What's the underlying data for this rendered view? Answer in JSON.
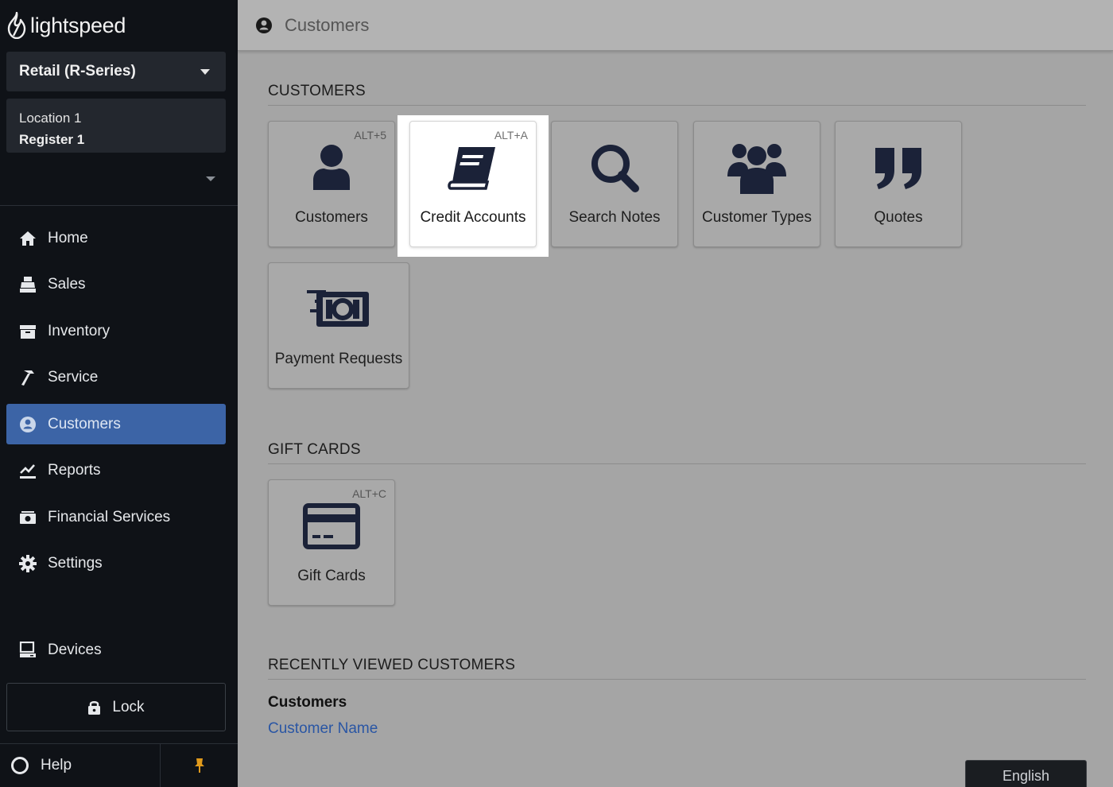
{
  "app": {
    "logo_text": "lightspeed"
  },
  "sidebar": {
    "product": "Retail (R-Series)",
    "location": "Location 1",
    "register": "Register 1",
    "nav": [
      {
        "label": "Home",
        "icon": "home-icon"
      },
      {
        "label": "Sales",
        "icon": "register-icon"
      },
      {
        "label": "Inventory",
        "icon": "inventory-icon"
      },
      {
        "label": "Service",
        "icon": "hammer-icon"
      },
      {
        "label": "Customers",
        "icon": "user-circle-icon",
        "active": true
      },
      {
        "label": "Reports",
        "icon": "chart-icon"
      },
      {
        "label": "Financial Services",
        "icon": "money-icon"
      },
      {
        "label": "Settings",
        "icon": "gear-icon"
      }
    ],
    "devices": "Devices",
    "lock": "Lock",
    "help": "Help"
  },
  "header": {
    "title": "Customers"
  },
  "sections": {
    "customers": {
      "heading": "CUSTOMERS",
      "tiles": [
        {
          "label": "Customers",
          "shortcut": "ALT+5",
          "icon": "user-icon"
        },
        {
          "label": "Credit Accounts",
          "shortcut": "ALT+A",
          "icon": "book-icon",
          "highlighted": true
        },
        {
          "label": "Search Notes",
          "shortcut": "",
          "icon": "search-icon"
        },
        {
          "label": "Customer Types",
          "shortcut": "",
          "icon": "users-icon"
        },
        {
          "label": "Quotes",
          "shortcut": "",
          "icon": "quote-icon"
        },
        {
          "label": "Payment Requests",
          "shortcut": "",
          "icon": "fast-money-icon"
        }
      ]
    },
    "gift_cards": {
      "heading": "GIFT CARDS",
      "tiles": [
        {
          "label": "Gift Cards",
          "shortcut": "ALT+C",
          "icon": "credit-card-icon"
        }
      ]
    },
    "recent": {
      "heading": "RECENTLY VIEWED CUSTOMERS",
      "subheading": "Customers",
      "link": "Customer Name"
    }
  },
  "footer": {
    "language": "English"
  },
  "colors": {
    "sidebar_bg": "#0f1217",
    "active_nav": "#3c64a6",
    "icon_dark": "#1b2238",
    "link": "#2a56a4",
    "pin": "#e09a1c"
  }
}
